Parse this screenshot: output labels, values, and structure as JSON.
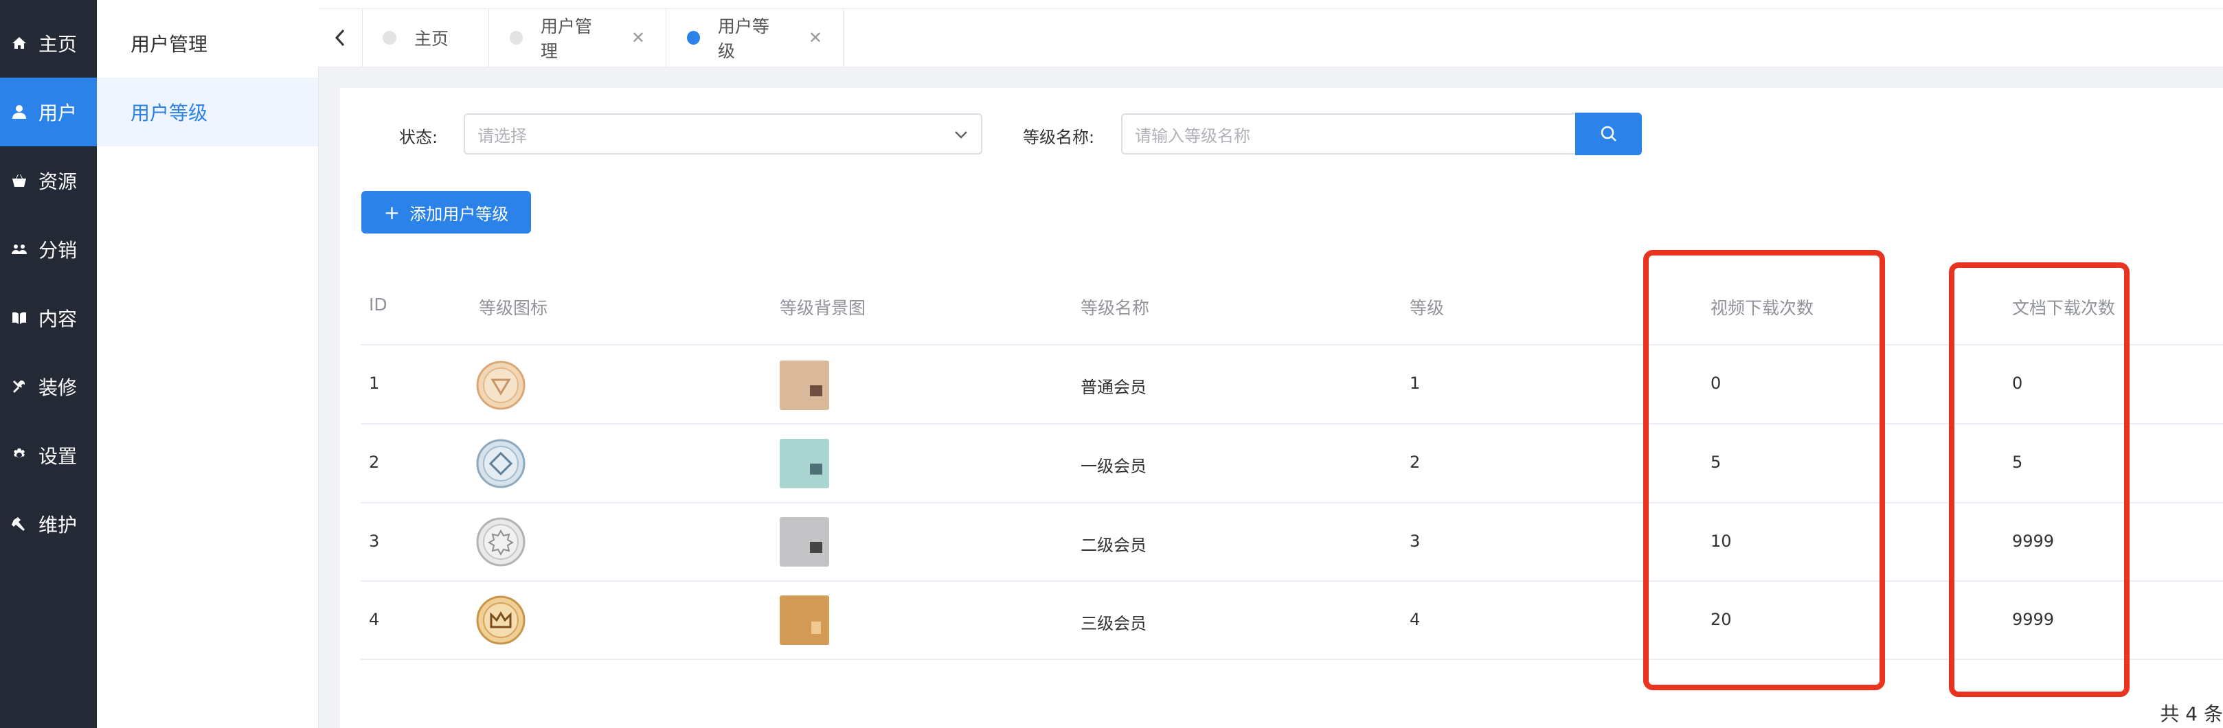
{
  "nav": {
    "items": [
      {
        "label": "主页",
        "icon": "home-icon"
      },
      {
        "label": "用户",
        "icon": "user-icon"
      },
      {
        "label": "资源",
        "icon": "basket-icon"
      },
      {
        "label": "分销",
        "icon": "group-icon"
      },
      {
        "label": "内容",
        "icon": "book-icon"
      },
      {
        "label": "装修",
        "icon": "tools-icon"
      },
      {
        "label": "设置",
        "icon": "gear-icon"
      },
      {
        "label": "维护",
        "icon": "hammer-icon"
      }
    ],
    "active_index": 1
  },
  "submenu": {
    "items": [
      {
        "label": "用户管理"
      },
      {
        "label": "用户等级"
      }
    ]
  },
  "tabs": [
    {
      "label": "主页",
      "closable": false
    },
    {
      "label": "用户管理",
      "closable": true
    },
    {
      "label": "用户等级",
      "closable": true,
      "active": true
    }
  ],
  "filters": {
    "status_label": "状态:",
    "status_placeholder": "请选择",
    "name_label": "等级名称:",
    "name_placeholder": "请输入等级名称"
  },
  "add_button": "添加用户等级",
  "table": {
    "headers": {
      "id": "ID",
      "icon": "等级图标",
      "bg": "等级背景图",
      "name": "等级名称",
      "level": "等级",
      "video": "视频下载次数",
      "doc": "文档下载次数"
    },
    "rows": [
      {
        "id": "1",
        "name": "普通会员",
        "level": "1",
        "video": "0",
        "doc": "0",
        "badge_color": "#f3d7b5",
        "badge_stroke": "#d9a878",
        "bg_color": "#d9b99a"
      },
      {
        "id": "2",
        "name": "一级会员",
        "level": "2",
        "video": "5",
        "doc": "5",
        "badge_color": "#d7e3ec",
        "badge_stroke": "#8ea8bd",
        "bg_color": "#a9d4cf"
      },
      {
        "id": "3",
        "name": "二级会员",
        "level": "3",
        "video": "10",
        "doc": "9999",
        "badge_color": "#e9e9e9",
        "badge_stroke": "#b3b3b3",
        "bg_color": "#c4c4c6"
      },
      {
        "id": "4",
        "name": "三级会员",
        "level": "4",
        "video": "20",
        "doc": "9999",
        "badge_color": "#f0cf94",
        "badge_stroke": "#c9954a",
        "bg_color": "#d39a55"
      }
    ]
  },
  "footer": {
    "total": "共 4 条"
  },
  "colors": {
    "accent": "#2b82e8",
    "nav_bg": "#232935",
    "highlight": "#e8331f"
  }
}
